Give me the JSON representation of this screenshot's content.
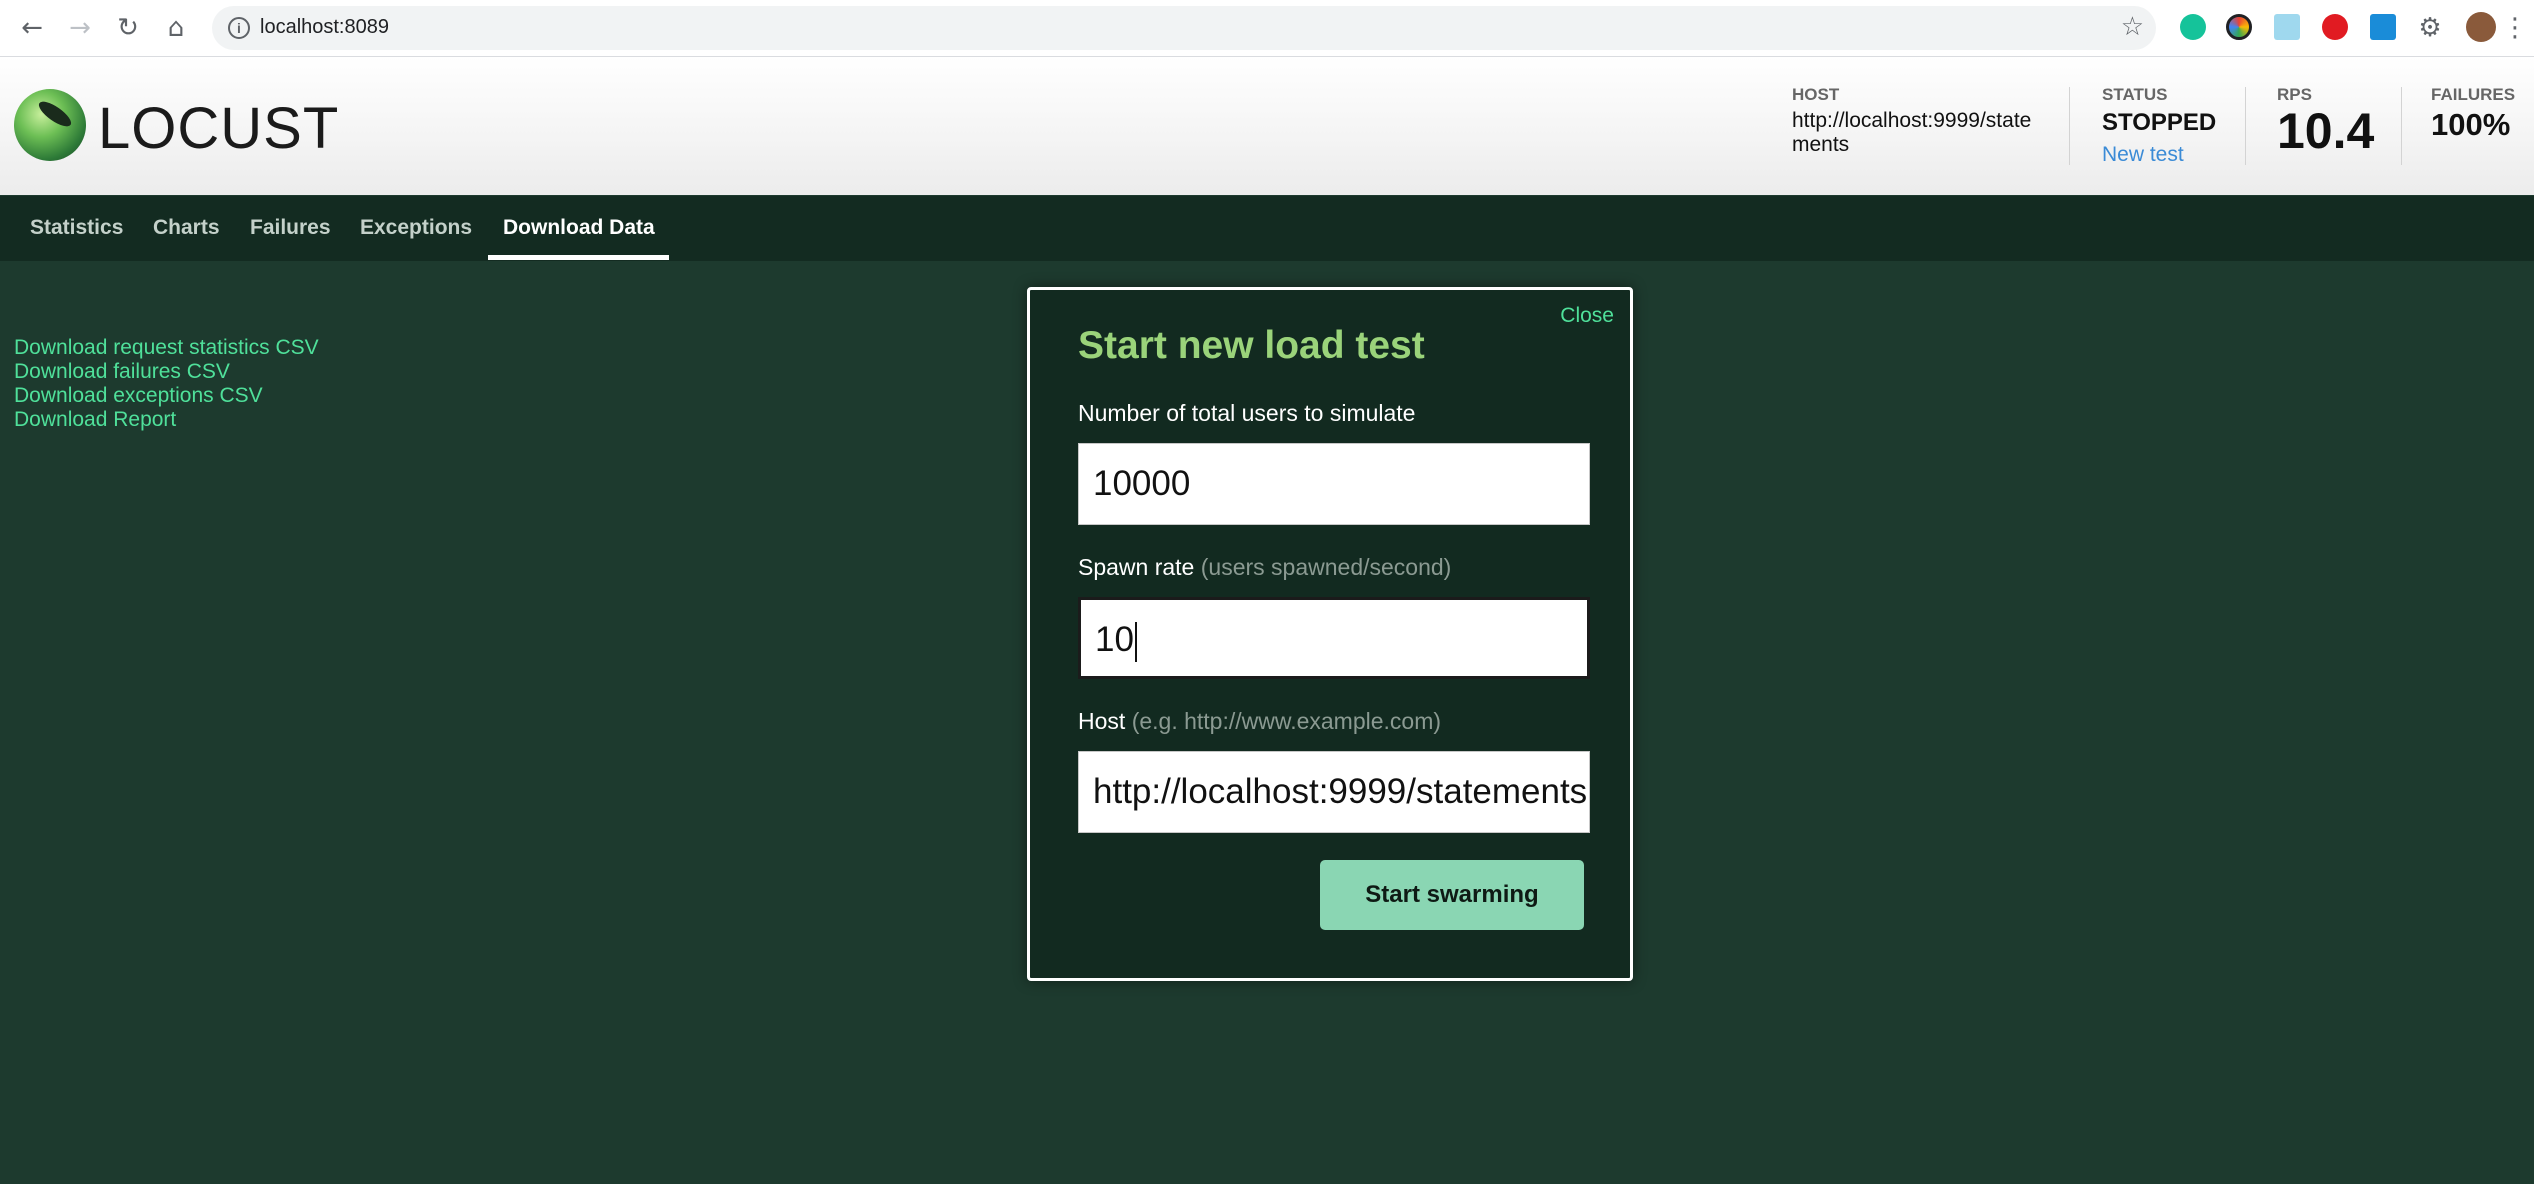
{
  "browser": {
    "url": "localhost:8089"
  },
  "app": {
    "logo_text": "LOCUST"
  },
  "header": {
    "host_label": "HOST",
    "host_value": "http://localhost:9999/statements",
    "status_label": "STATUS",
    "status_value": "STOPPED",
    "new_test_link": "New test",
    "rps_label": "RPS",
    "rps_value": "10.4",
    "failures_label": "FAILURES",
    "failures_value": "100%"
  },
  "tabs": [
    {
      "label": "Statistics",
      "active": false
    },
    {
      "label": "Charts",
      "active": false
    },
    {
      "label": "Failures",
      "active": false
    },
    {
      "label": "Exceptions",
      "active": false
    },
    {
      "label": "Download Data",
      "active": true
    }
  ],
  "downloads": [
    {
      "label": "Download request statistics CSV"
    },
    {
      "label": "Download failures CSV"
    },
    {
      "label": "Download exceptions CSV"
    },
    {
      "label": "Download Report"
    }
  ],
  "modal": {
    "close_label": "Close",
    "title": "Start new load test",
    "users_label": "Number of total users to simulate",
    "users_value": "10000",
    "spawn_label": "Spawn rate",
    "spawn_hint": "(users spawned/second)",
    "spawn_value": "10",
    "host_label": "Host",
    "host_hint": "(e.g. http://www.example.com)",
    "host_value": "http://localhost:9999/statements",
    "start_button": "Start swarming"
  },
  "colors": {
    "page_background": "#1d3a2e",
    "tab_bar": "#132b21",
    "link_green": "#4fe09a",
    "title_green": "#9ad37a",
    "button_green": "#8ad6b3",
    "new_test_blue": "#3b8bd6"
  },
  "icons": [
    "back-icon",
    "forward-icon",
    "reload-icon",
    "home-icon",
    "info-icon",
    "star-icon",
    "extensions-icon"
  ]
}
